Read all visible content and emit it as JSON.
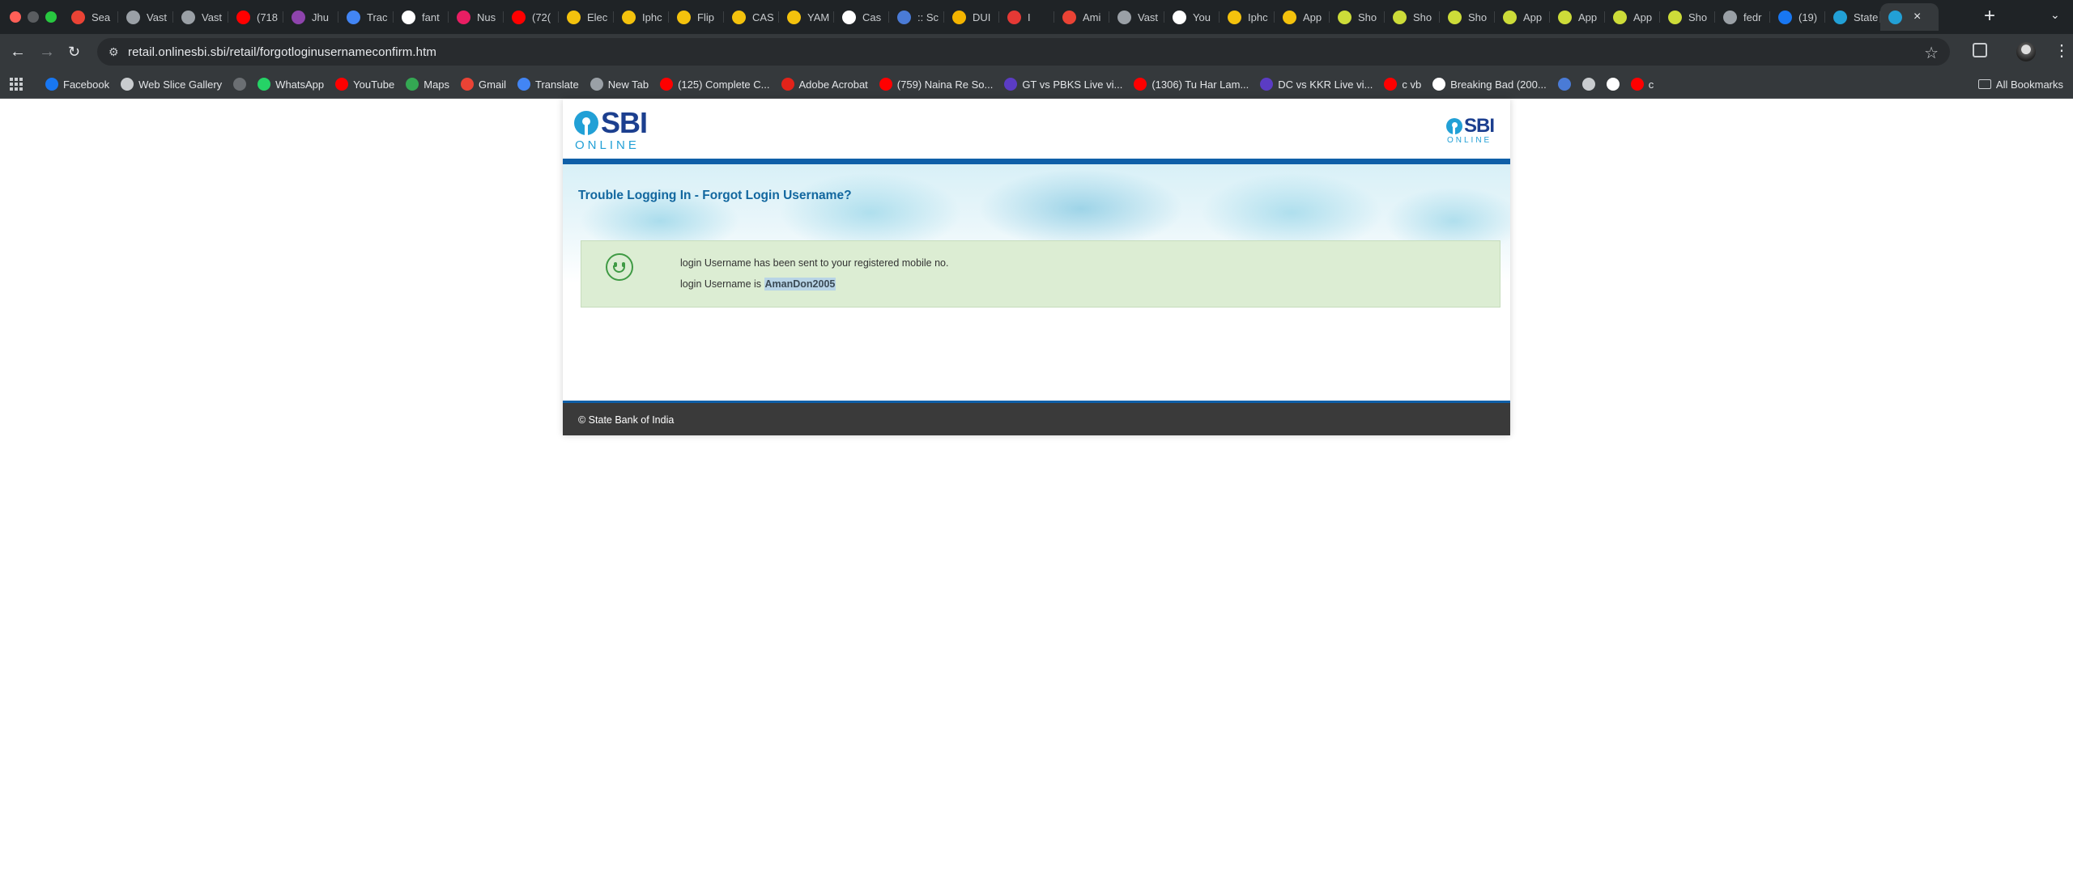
{
  "browser": {
    "tabs": [
      {
        "title": "Sea",
        "icon": "gmail-icon",
        "color": "#ea4335"
      },
      {
        "title": "Vast",
        "icon": "globe-icon",
        "color": "#9aa0a6"
      },
      {
        "title": "Vast",
        "icon": "globe-icon",
        "color": "#9aa0a6"
      },
      {
        "title": "(718",
        "icon": "youtube-icon",
        "color": "#ff0000"
      },
      {
        "title": "Jhu",
        "icon": "app-icon",
        "color": "#8e44ad"
      },
      {
        "title": "Trac",
        "icon": "play-icon",
        "color": "#4285f4"
      },
      {
        "title": "fant",
        "icon": "google-icon",
        "color": "#ffffff"
      },
      {
        "title": "Nus",
        "icon": "app-icon",
        "color": "#e91e63"
      },
      {
        "title": "(72(",
        "icon": "youtube-icon",
        "color": "#ff0000"
      },
      {
        "title": "Elec",
        "icon": "note-icon",
        "color": "#f4c20d"
      },
      {
        "title": "Iphc",
        "icon": "note-icon",
        "color": "#f4c20d"
      },
      {
        "title": "Flip",
        "icon": "note-icon",
        "color": "#f4c20d"
      },
      {
        "title": "CAS",
        "icon": "note-icon",
        "color": "#f4c20d"
      },
      {
        "title": "YAM",
        "icon": "note-icon",
        "color": "#f4c20d"
      },
      {
        "title": "Cas",
        "icon": "app-icon",
        "color": "#ffffff"
      },
      {
        "title": ":: Sc",
        "icon": "globe-icon",
        "color": "#4a7bd6"
      },
      {
        "title": "DUI",
        "icon": "app-icon",
        "color": "#f4b400"
      },
      {
        "title": "I",
        "icon": "app-icon",
        "color": "#e53935"
      },
      {
        "title": "Ami",
        "icon": "gmail-icon",
        "color": "#ea4335"
      },
      {
        "title": "Vast",
        "icon": "globe-icon",
        "color": "#9aa0a6"
      },
      {
        "title": "You",
        "icon": "app-icon",
        "color": "#ffffff"
      },
      {
        "title": "Iphc",
        "icon": "note-icon",
        "color": "#f4c20d"
      },
      {
        "title": "App",
        "icon": "note-icon",
        "color": "#f4c20d"
      },
      {
        "title": "Sho",
        "icon": "app-icon",
        "color": "#cddc39"
      },
      {
        "title": "Sho",
        "icon": "app-icon",
        "color": "#cddc39"
      },
      {
        "title": "Sho",
        "icon": "app-icon",
        "color": "#cddc39"
      },
      {
        "title": "App",
        "icon": "app-icon",
        "color": "#cddc39"
      },
      {
        "title": "App",
        "icon": "app-icon",
        "color": "#cddc39"
      },
      {
        "title": "App",
        "icon": "app-icon",
        "color": "#cddc39"
      },
      {
        "title": "Sho",
        "icon": "app-icon",
        "color": "#cddc39"
      },
      {
        "title": "fedr",
        "icon": "globe-icon",
        "color": "#9aa0a6"
      },
      {
        "title": "(19)",
        "icon": "facebook-icon",
        "color": "#1877f2"
      },
      {
        "title": "State",
        "icon": "sbi-icon",
        "color": "#22a0d6"
      }
    ],
    "active_tab": {
      "icon": "sbi-icon",
      "color": "#22a0d6"
    },
    "url": "retail.onlinesbi.sbi/retail/forgotloginusernameconfirm.htm",
    "bookmarks": [
      {
        "label": "Facebook",
        "icon": "facebook-icon",
        "color": "#1877f2"
      },
      {
        "label": "Web Slice Gallery",
        "icon": "web-slice-icon",
        "color": "#c9cccf"
      },
      {
        "label": "",
        "icon": "blank-page-icon",
        "color": "#6b6f73"
      },
      {
        "label": "WhatsApp",
        "icon": "whatsapp-icon",
        "color": "#25d366"
      },
      {
        "label": "YouTube",
        "icon": "youtube-icon",
        "color": "#ff0000"
      },
      {
        "label": "Maps",
        "icon": "maps-icon",
        "color": "#34a853"
      },
      {
        "label": "Gmail",
        "icon": "gmail-icon",
        "color": "#ea4335"
      },
      {
        "label": "Translate",
        "icon": "translate-icon",
        "color": "#4285f4"
      },
      {
        "label": "New Tab",
        "icon": "globe-icon",
        "color": "#9aa0a6"
      },
      {
        "label": "(125) Complete C...",
        "icon": "youtube-icon",
        "color": "#ff0000"
      },
      {
        "label": "Adobe Acrobat",
        "icon": "acrobat-icon",
        "color": "#e2231a"
      },
      {
        "label": "(759) Naina Re So...",
        "icon": "youtube-icon",
        "color": "#ff0000"
      },
      {
        "label": "GT vs PBKS Live vi...",
        "icon": "cricket-icon",
        "color": "#5b3cc4"
      },
      {
        "label": "(1306) Tu Har Lam...",
        "icon": "youtube-icon",
        "color": "#ff0000"
      },
      {
        "label": "DC vs KKR Live vi...",
        "icon": "cricket-icon",
        "color": "#5b3cc4"
      },
      {
        "label": "c vb",
        "icon": "youtube-icon",
        "color": "#ff0000"
      },
      {
        "label": "Breaking Bad (200...",
        "icon": "app-icon",
        "color": "#ffffff"
      },
      {
        "label": "",
        "icon": "graduation-cap-icon",
        "color": "#4a7bd6"
      },
      {
        "label": "",
        "icon": "devanagari-icon",
        "color": "#c9cccf"
      },
      {
        "label": "",
        "icon": "google-icon",
        "color": "#ffffff"
      },
      {
        "label": "c",
        "icon": "youtube-icon",
        "color": "#ff0000"
      }
    ],
    "all_bookmarks_label": "All Bookmarks"
  },
  "sbi": {
    "logo_word": "SBI",
    "logo_sub": "ONLINE",
    "brand_blue": "#1c3f8f",
    "brand_cyan": "#22a0d6",
    "page_title": "Trouble Logging In - Forgot Login Username?",
    "message_line1": "login Username has been sent to your registered mobile no.",
    "message_line2_prefix": "login Username is ",
    "username": "AmanDon2005",
    "footer": "© State Bank of India"
  }
}
